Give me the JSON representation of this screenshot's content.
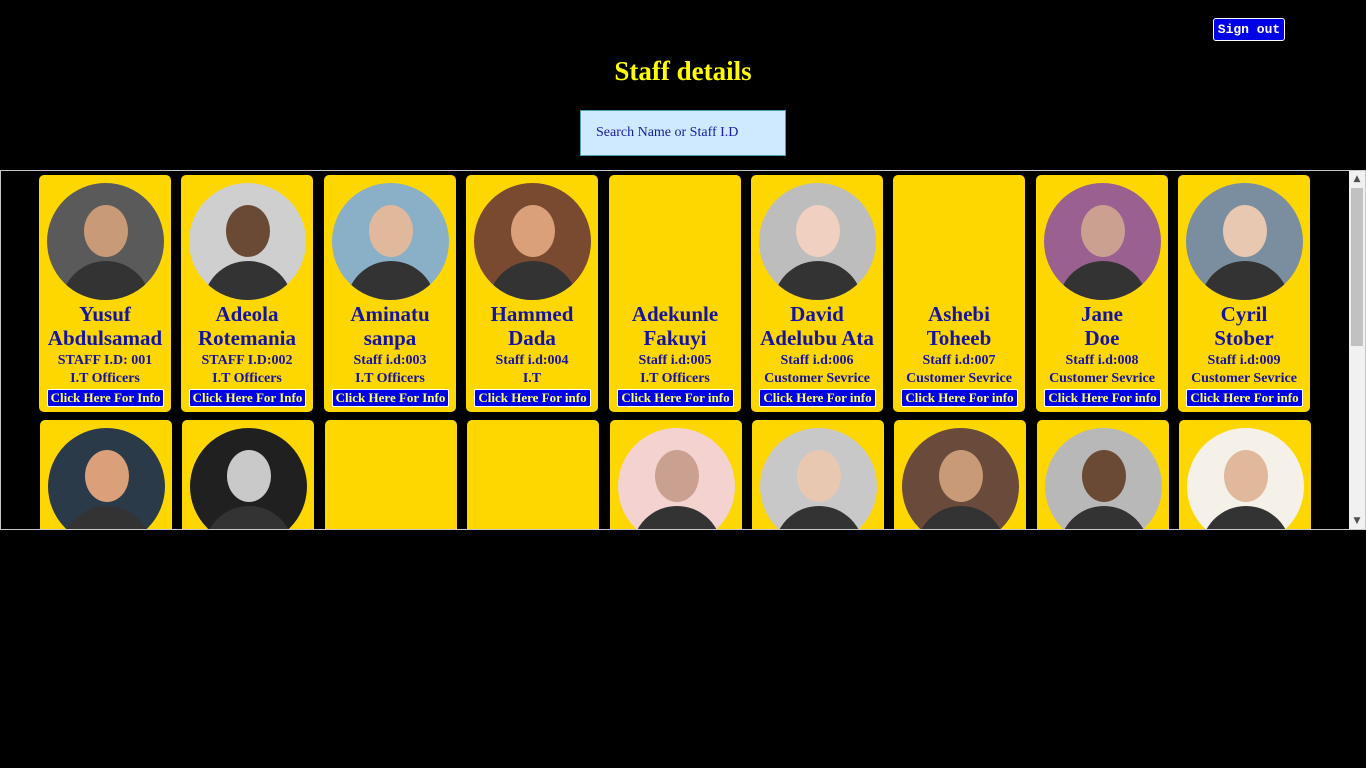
{
  "header": {
    "signout_label": "Sign out",
    "title": "Staff details"
  },
  "search": {
    "placeholder": "Search Name or Staff I.D"
  },
  "info_labels": {
    "upper": "Click Here For Info",
    "lower": "Click Here For info"
  },
  "staff_row1": [
    {
      "name_line1": "Yusuf",
      "name_line2": "Abdulsamad",
      "staff_id": "STAFF I.D: 001",
      "department": "I.T Officers",
      "button": "Click Here For Info",
      "has_photo": true
    },
    {
      "name_line1": "Adeola",
      "name_line2": "Rotemania",
      "staff_id": "STAFF I.D:002",
      "department": "I.T Officers",
      "button": "Click Here For Info",
      "has_photo": true
    },
    {
      "name_line1": "Aminatu",
      "name_line2": "sanpa",
      "staff_id": "Staff i.d:003",
      "department": "I.T Officers",
      "button": "Click Here For Info",
      "has_photo": true
    },
    {
      "name_line1": "Hammed",
      "name_line2": "Dada",
      "staff_id": "Staff i.d:004",
      "department": "I.T",
      "button": "Click Here For info",
      "has_photo": true
    },
    {
      "name_line1": "Adekunle",
      "name_line2": "Fakuyi",
      "staff_id": "Staff i.d:005",
      "department": "I.T Officers",
      "button": "Click Here For info",
      "has_photo": false
    },
    {
      "name_line1": "David",
      "name_line2": "Adelubu Ata",
      "staff_id": "Staff i.d:006",
      "department": "Customer Sevrice",
      "button": "Click Here For info",
      "has_photo": true
    },
    {
      "name_line1": "Ashebi",
      "name_line2": "Toheeb",
      "staff_id": "Staff i.d:007",
      "department": "Customer Sevrice",
      "button": "Click Here For info",
      "has_photo": false
    },
    {
      "name_line1": "Jane",
      "name_line2": "Doe",
      "staff_id": "Staff i.d:008",
      "department": "Customer Sevrice",
      "button": "Click Here For info",
      "has_photo": true
    },
    {
      "name_line1": "Cyril",
      "name_line2": "Stober",
      "staff_id": "Staff i.d:009",
      "department": "Customer Sevrice",
      "button": "Click Here For info",
      "has_photo": true
    }
  ],
  "staff_row2_photos": [
    true,
    true,
    false,
    false,
    true,
    true,
    true,
    true,
    true
  ],
  "colors": {
    "card": "#ffd700",
    "text": "#1414a0",
    "button": "#0000e6",
    "title": "#ffff00",
    "background": "#000000"
  }
}
